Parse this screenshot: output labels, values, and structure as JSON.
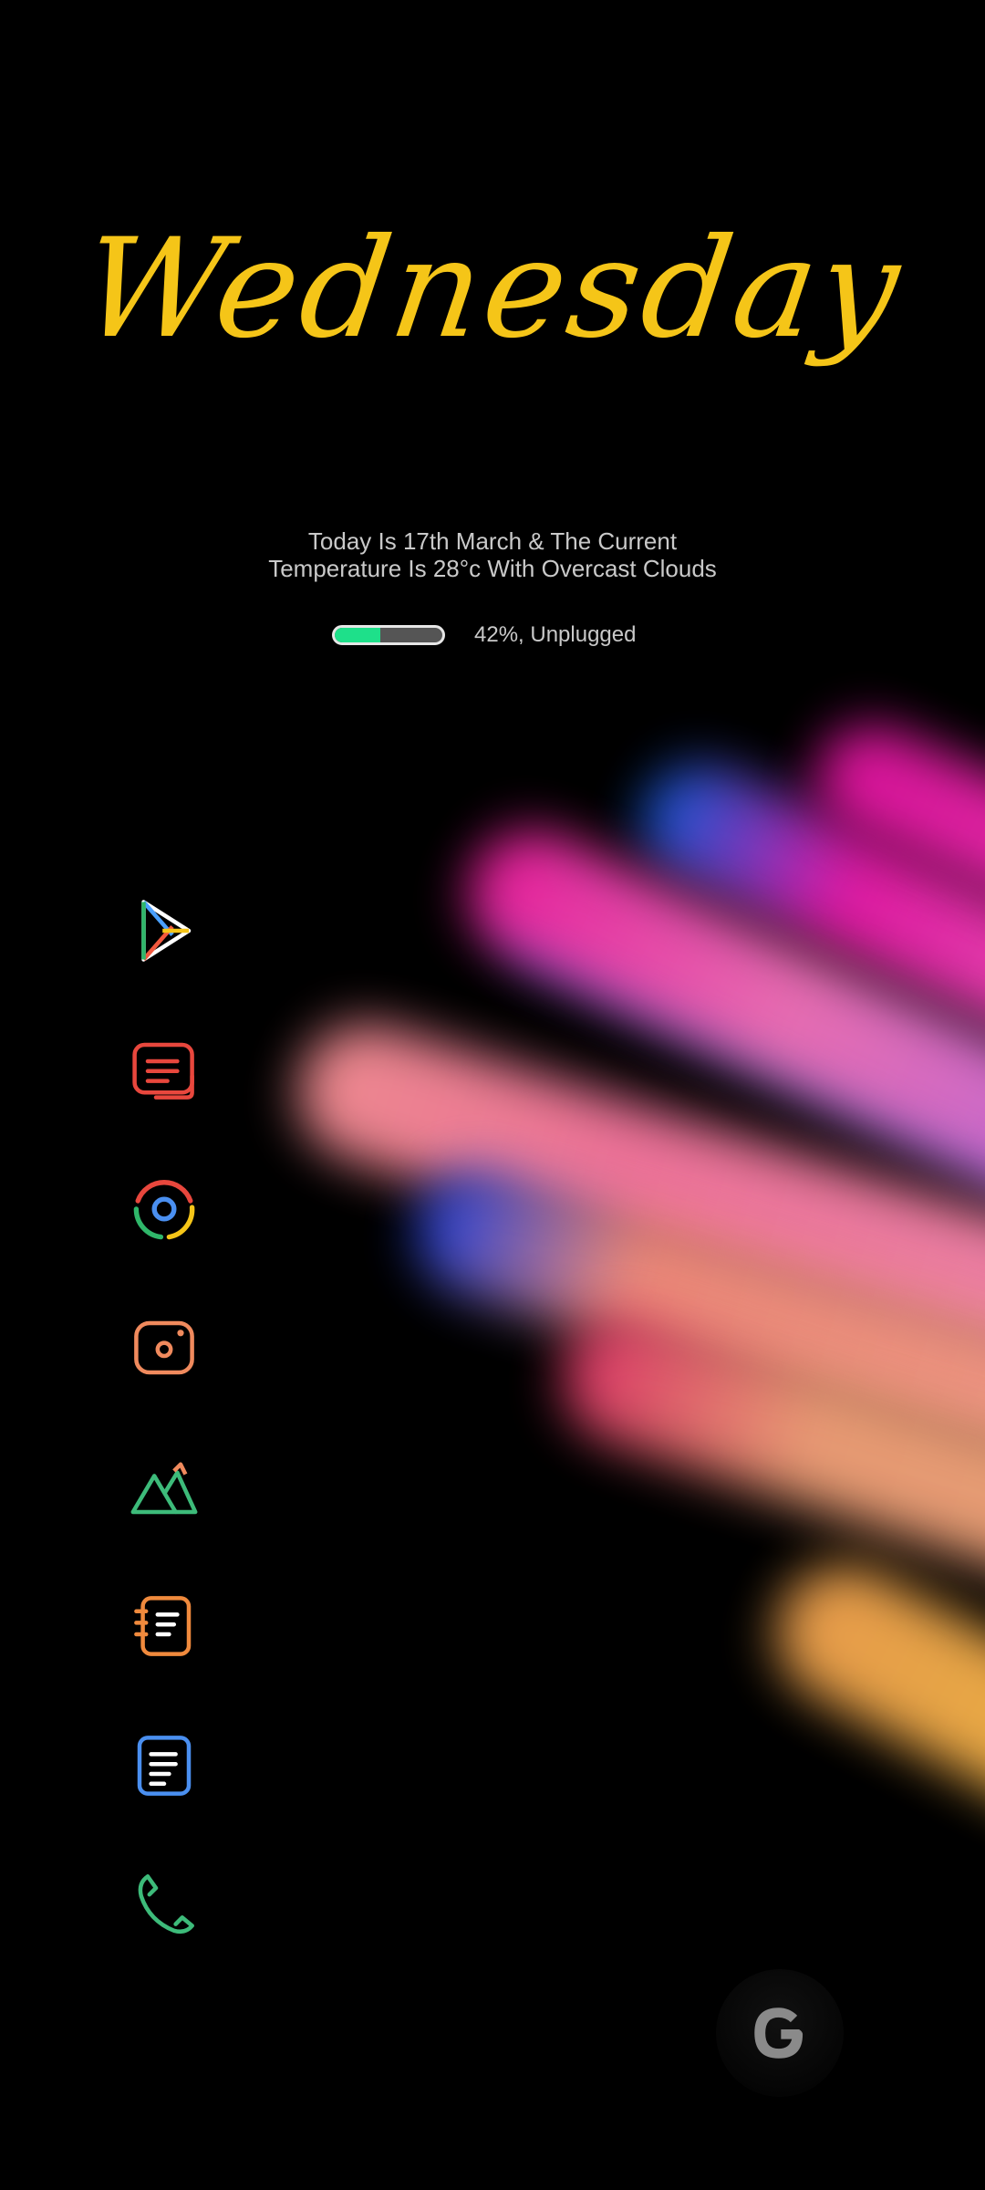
{
  "widget": {
    "day": "Wednesday",
    "info_line1": "Today Is 17th March & The Current",
    "info_line2": "Temperature Is 28°c With Overcast Clouds",
    "battery_level": 0.42,
    "battery_label": "42%, Unplugged",
    "colors": {
      "day_text": "#f5c518",
      "battery_fill": "#1ee08a"
    }
  },
  "dock": {
    "apps": [
      {
        "icon": "play-store-icon"
      },
      {
        "icon": "messages-icon"
      },
      {
        "icon": "chrome-icon"
      },
      {
        "icon": "camera-icon"
      },
      {
        "icon": "gallery-icon"
      },
      {
        "icon": "contacts-icon"
      },
      {
        "icon": "notes-icon"
      },
      {
        "icon": "phone-icon"
      }
    ]
  },
  "search": {
    "icon": "google-icon"
  }
}
